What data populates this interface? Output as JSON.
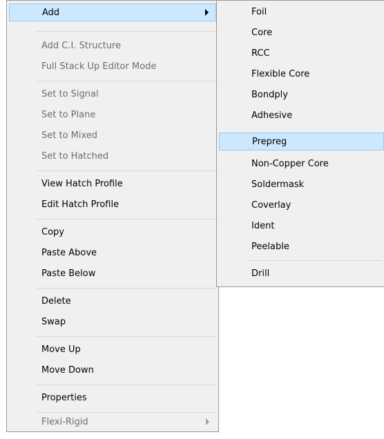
{
  "main_menu": {
    "items": [
      {
        "label": "Add",
        "enabled": true,
        "highlighted": true,
        "has_submenu": true
      },
      {
        "label": "Add C.I. Structure",
        "enabled": false
      },
      {
        "label": "Full Stack Up Editor Mode",
        "enabled": false
      },
      {
        "label": "Set to Signal",
        "enabled": false
      },
      {
        "label": "Set to Plane",
        "enabled": false
      },
      {
        "label": "Set to Mixed",
        "enabled": false
      },
      {
        "label": "Set to Hatched",
        "enabled": false
      },
      {
        "label": "View Hatch Profile",
        "enabled": true
      },
      {
        "label": "Edit Hatch Profile",
        "enabled": true
      },
      {
        "label": "Copy",
        "enabled": true
      },
      {
        "label": "Paste Above",
        "enabled": true
      },
      {
        "label": "Paste Below",
        "enabled": true
      },
      {
        "label": "Delete",
        "enabled": true
      },
      {
        "label": "Swap",
        "enabled": true
      },
      {
        "label": "Move Up",
        "enabled": true
      },
      {
        "label": "Move Down",
        "enabled": true
      },
      {
        "label": "Properties",
        "enabled": true
      },
      {
        "label": "Flexi-Rigid",
        "enabled": false,
        "has_submenu": true
      }
    ]
  },
  "add_submenu": {
    "items": [
      {
        "label": "Foil"
      },
      {
        "label": "Core"
      },
      {
        "label": "RCC"
      },
      {
        "label": "Flexible Core"
      },
      {
        "label": "Bondply"
      },
      {
        "label": "Adhesive"
      },
      {
        "label": "Prepreg",
        "highlighted": true
      },
      {
        "label": "Non-Copper Core"
      },
      {
        "label": "Soldermask"
      },
      {
        "label": "Coverlay"
      },
      {
        "label": "Ident"
      },
      {
        "label": "Peelable"
      },
      {
        "label": "Drill"
      }
    ]
  },
  "colors": {
    "menu_background": "#f0f0f0",
    "menu_border": "#979797",
    "highlight_fill": "#cce8ff",
    "highlight_border": "#99c9ef",
    "disabled_text": "#6d6d6d",
    "separator": "#d7d7d7"
  }
}
